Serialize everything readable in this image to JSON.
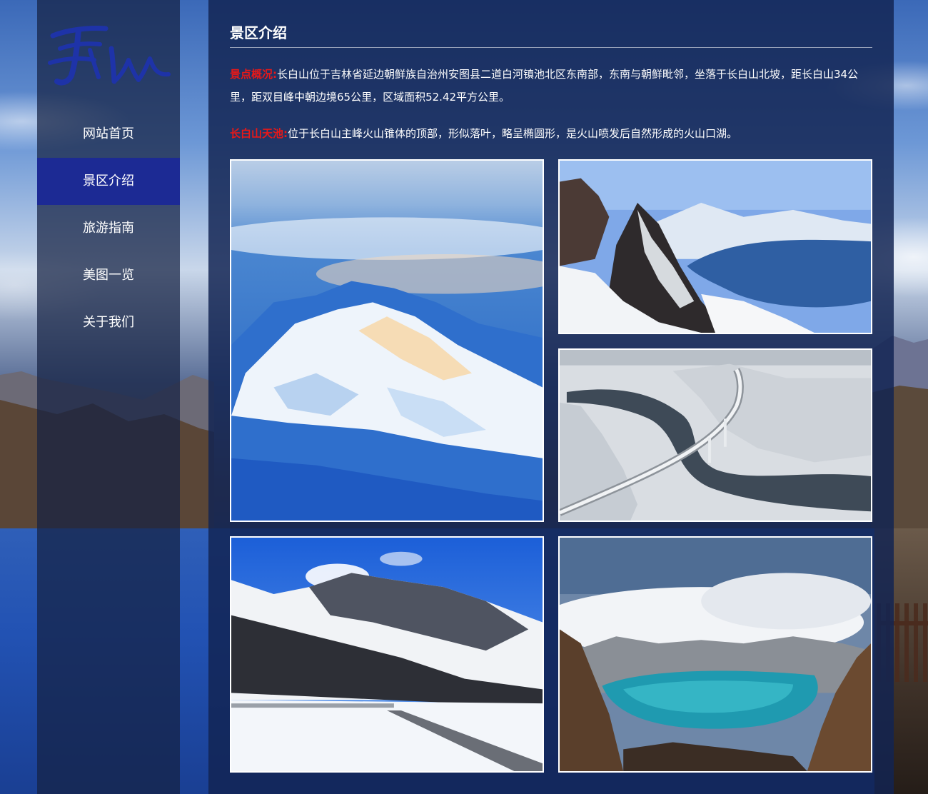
{
  "colors": {
    "sidebar_active": "#1c2a94",
    "label_red": "#e81818",
    "text": "#ffffff"
  },
  "sidebar": {
    "logo_icon": "calligraphy-logo-icon",
    "items": [
      {
        "label": "网站首页",
        "active": false
      },
      {
        "label": "景区介绍",
        "active": true
      },
      {
        "label": "旅游指南",
        "active": false
      },
      {
        "label": "美图一览",
        "active": false
      },
      {
        "label": "关于我们",
        "active": false
      }
    ]
  },
  "main": {
    "title": "景区介绍",
    "paragraphs": [
      {
        "label": "景点概况:",
        "text": "长白山位于吉林省延边朝鲜族自治州安图县二道白河镇池北区东南部，东南与朝鲜毗邻，坐落于长白山北坡，距长白山34公里，距双目峰中朝边境65公里，区域面积52.42平方公里。"
      },
      {
        "label": "长白山天池:",
        "text": "位于长白山主峰火山锥体的顶部，形似落叶，略呈椭圆形，是火山喷发后自然形成的火山口湖。"
      }
    ],
    "photos": [
      "aerial-snow-mountain-image",
      "tianchi-crater-lake-snow-image",
      "snowy-forest-bridge-image",
      "snow-valley-boardwalk-image",
      "turquoise-crater-lake-image"
    ]
  }
}
